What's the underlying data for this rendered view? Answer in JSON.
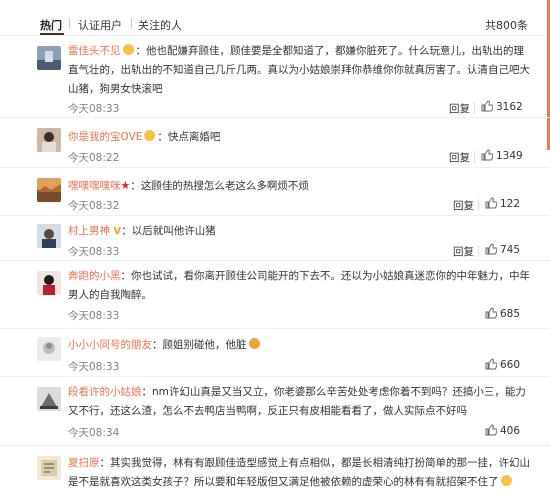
{
  "tabs": [
    {
      "label": "热门"
    },
    {
      "label": "认证用户"
    },
    {
      "label": "关注的人"
    }
  ],
  "total_count": "共800条",
  "reply_label": "回复",
  "comments": [
    {
      "user": "雷佳头不见",
      "text": "：他也配嫌弃顾佳，顾佳要是全都知道了，都嫌你脏死了。什么玩意儿，出轨出的理直气壮的，出轨出的不知道自己几斤几两。真以为小姑娘崇拜你恭维你你就真厉害了。认清自己吧大山猪，狗男女快滚吧",
      "time": "今天08:33",
      "likes": "3162"
    },
    {
      "user": "你是我的宝OVE",
      "text": "：快点离婚吧",
      "time": "今天08:22",
      "likes": "1349"
    },
    {
      "user": "嘿嘿嘿嘿咪",
      "text": "：这顾佳的热搜怎么老这么多啊烦不烦",
      "time": "今天08:32",
      "likes": "122"
    },
    {
      "user": "村上男神",
      "text": "：以后就叫他许山猪",
      "time": "今天08:33",
      "likes": "745"
    },
    {
      "user": "奔跑的小黑",
      "text": "：你也试试，看你离开顾佳公司能开的下去不。还以为小姑娘真迷恋你的中年魅力，中年男人的自我陶醉。",
      "time": "今天08:33",
      "likes": "685"
    },
    {
      "user": "小小小同号的朋友",
      "text": "：顾姐别碰他，他脏",
      "time": "今天08:33",
      "likes": "660"
    },
    {
      "user": "段看许的小姑娘",
      "text": "：nm许幻山真是又当又立，你老婆那么辛苦处处考虑你着不到吗？还搞小三，能力又不行，还这么渣，怎么不去鸭店当鸭啊，反正只有皮相能看看了，做人实际点不好吗",
      "time": "今天08:34",
      "likes": "406"
    },
    {
      "user": "夏扫原",
      "text": "：其实我觉得，林有有跟顾佳造型感觉上有点相似，都是长相清纯打扮简单的那一挂，许幻山是不是就喜欢这类女孩子？所以要和年轻版但又满足他被依赖的虚荣心的林有有就招架不住了",
      "time": "",
      "likes": ""
    }
  ],
  "colors": {
    "username": "#eb7350",
    "accent_bar": "#f37a3a",
    "time": "#808080"
  }
}
